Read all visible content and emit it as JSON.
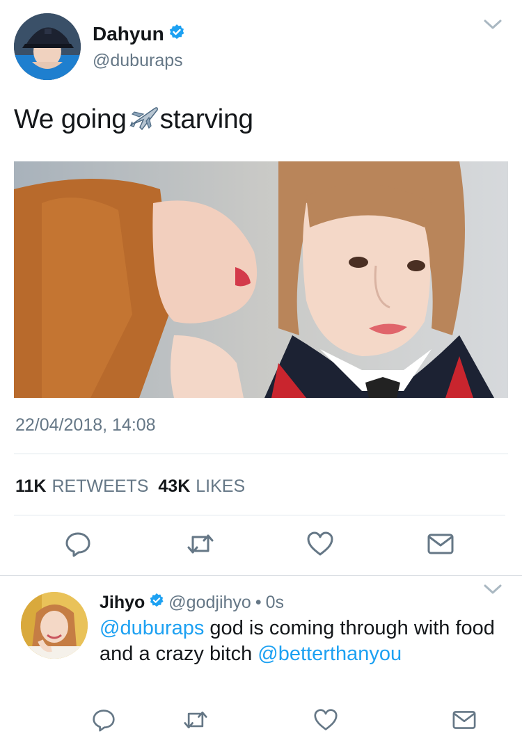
{
  "tweet": {
    "author_name": "Dahyun",
    "author_handle": "@duburaps",
    "verified_icon": "verified-badge-icon",
    "text_before": "We going",
    "emoji": "airplane",
    "text_after": "starving",
    "timestamp": "22/04/2018, 14:08",
    "retweets_count": "11K",
    "retweets_label": "RETWEETS",
    "likes_count": "43K",
    "likes_label": "LIKES"
  },
  "reply": {
    "author_name": "Jihyo",
    "author_handle": "@godjihyo",
    "separator": "•",
    "time": "0s",
    "mention1": "@duburaps",
    "text_mid": " god is coming through with food and a crazy bitch ",
    "mention2": "@betterthanyou"
  },
  "colors": {
    "link": "#1da1f2",
    "secondary_text": "#657786",
    "verified": "#1da1f2",
    "icon_gray": "#657786"
  },
  "icons": [
    "reply-icon",
    "retweet-icon",
    "like-icon",
    "message-icon",
    "chevron-down-icon",
    "verified-badge-icon"
  ]
}
